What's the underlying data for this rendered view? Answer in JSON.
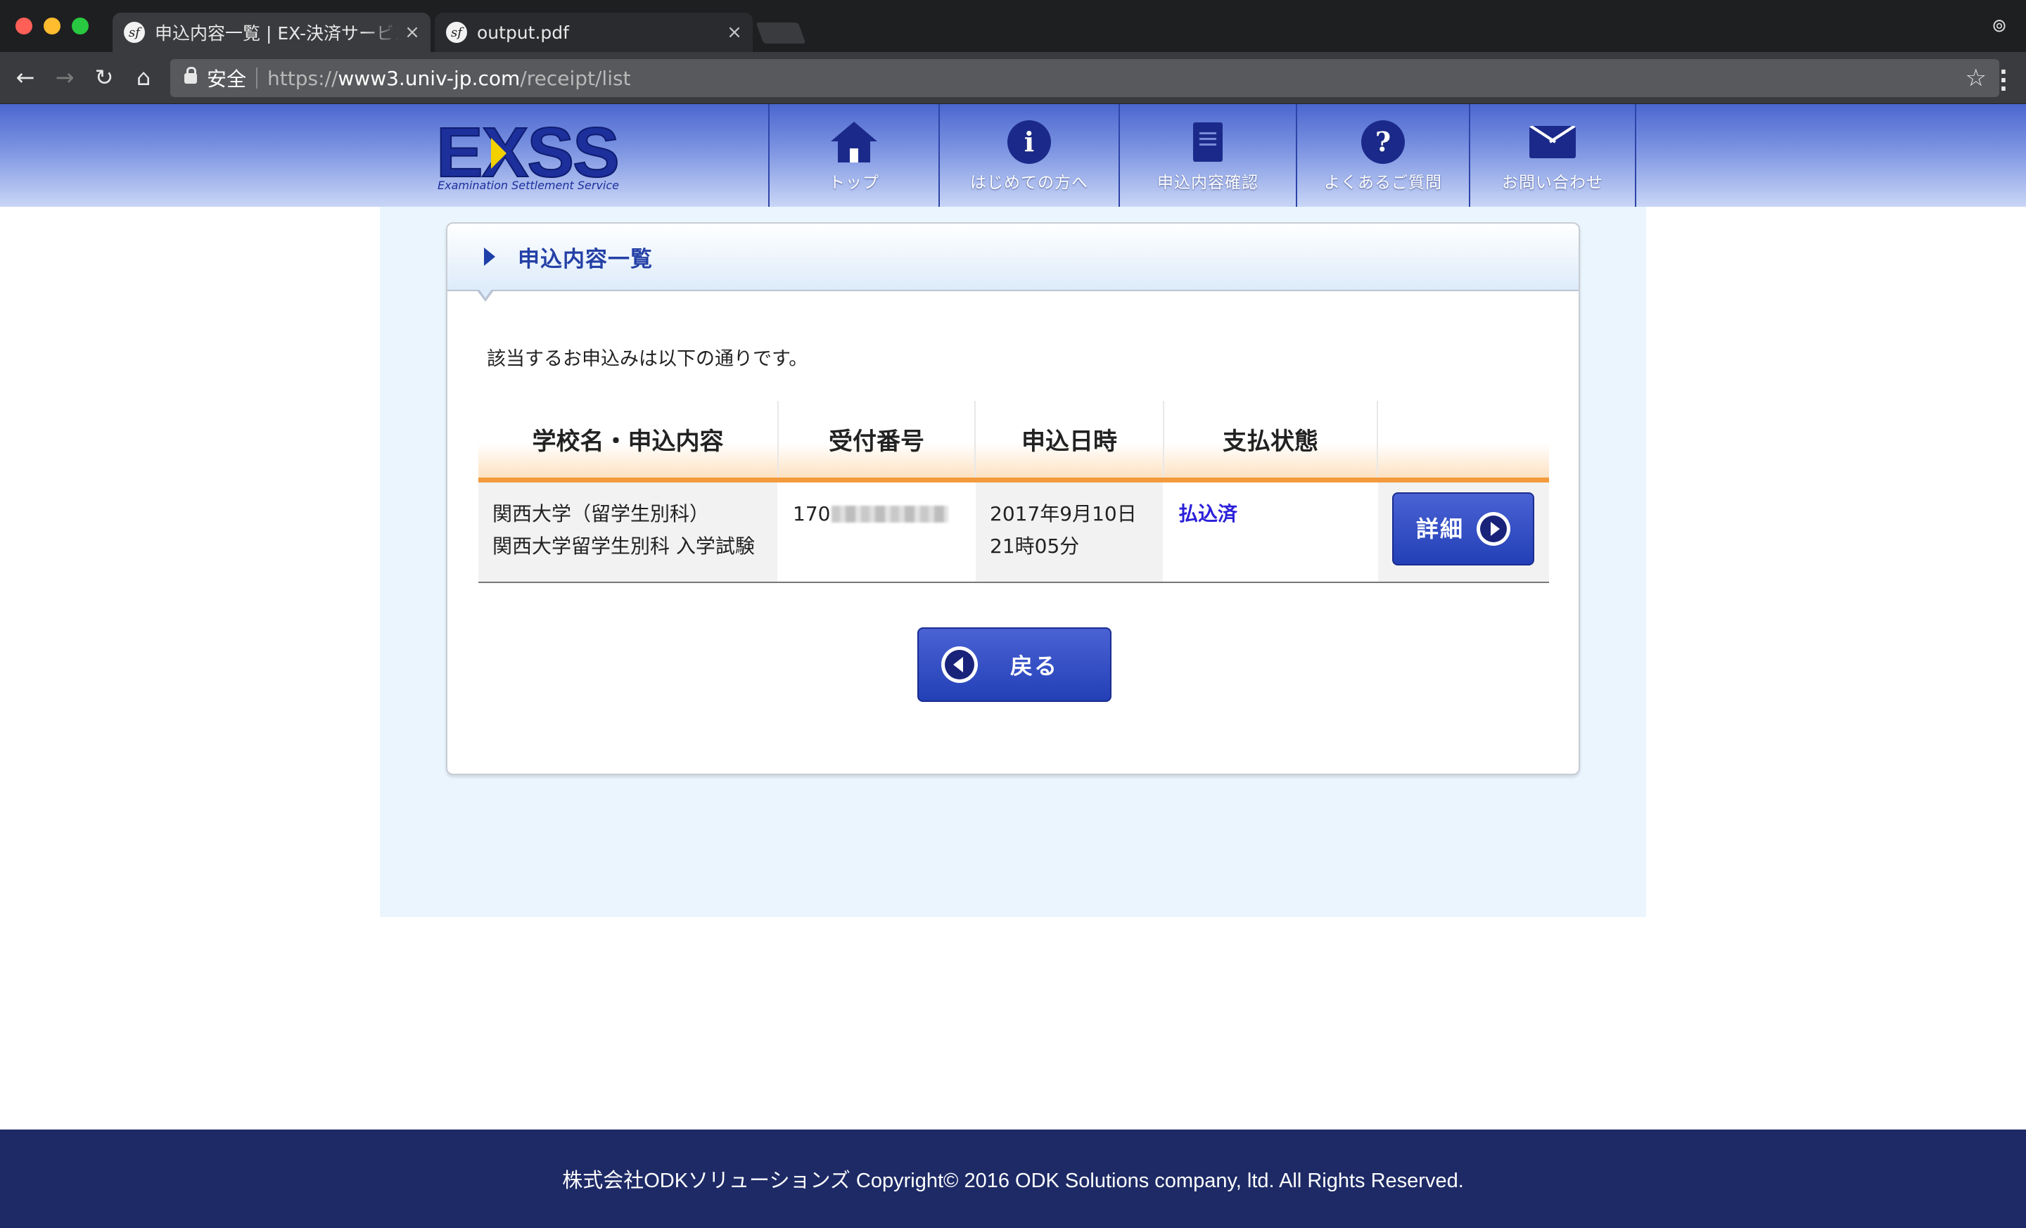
{
  "browser": {
    "tabs": [
      {
        "title": "申込内容一覧 | EX-決済サービス",
        "close": "×",
        "favicon": "sf"
      },
      {
        "title": "output.pdf",
        "close": "×",
        "favicon": "sf"
      }
    ],
    "secure_label": "安全",
    "url": {
      "scheme": "https://",
      "host": "www3.univ-jp.com",
      "path": "/receipt/list"
    },
    "icons": [
      "back-icon",
      "forward-icon",
      "reload-icon",
      "home-icon",
      "lock-icon",
      "star-icon",
      "menu-icon",
      "incognito-icon"
    ]
  },
  "site": {
    "logo_text": "EXSS",
    "logo_sub": "Examination Settlement Service",
    "nav": [
      {
        "label": "トップ",
        "icon": "house-icon"
      },
      {
        "label": "はじめての方へ",
        "icon": "info-icon",
        "glyph": "i"
      },
      {
        "label": "申込内容確認",
        "icon": "document-icon"
      },
      {
        "label": "よくあるご質問",
        "icon": "question-icon",
        "glyph": "?"
      },
      {
        "label": "お問い合わせ",
        "icon": "mail-icon"
      }
    ]
  },
  "panel": {
    "title": "申込内容一覧",
    "intro": "該当するお申込みは以下の通りです。",
    "table": {
      "headers": [
        "学校名・申込内容",
        "受付番号",
        "申込日時",
        "支払状態",
        ""
      ],
      "rows": [
        {
          "school": "関西大学（留学生別科）",
          "exam": "関西大学留学生別科 入学試験",
          "receipt_no": "170",
          "date": "2017年9月10日",
          "time": "21時05分",
          "status": "払込済",
          "action": "詳細"
        }
      ]
    },
    "back_label": "戻る"
  },
  "footer": {
    "text": "株式会社ODKソリューションズ Copyright© 2016 ODK Solutions company, ltd. All Rights Reserved."
  },
  "colors": {
    "header_blue": "#4b67cf",
    "nav_icon": "#1b2a8a",
    "table_accent": "#f39a3c",
    "paid_status": "#2b20d9",
    "footer_bg": "#1d2a66",
    "content_bg": "#eaf5fd"
  }
}
